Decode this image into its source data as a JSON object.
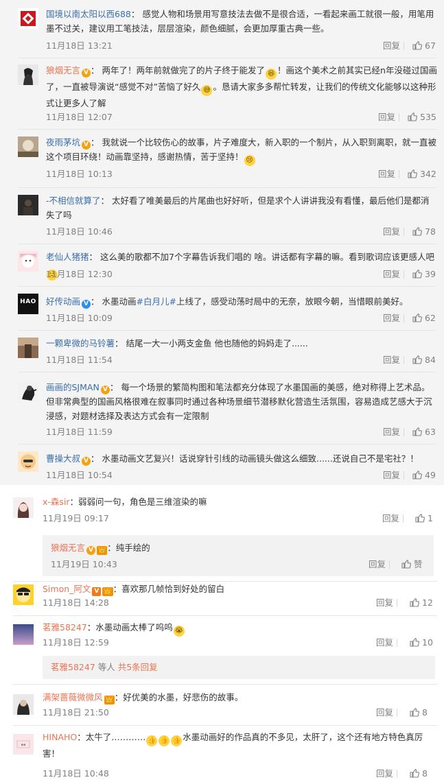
{
  "section_a": [
    {
      "name": "国境以南太阳以西688",
      "name_color": "blue",
      "badge": "",
      "text": "感觉人物和场景用写意技法去做不是很合适，一看起来画工就很一般，用笔用墨不过关，建议用工笔技法，层层渲染，颜色细腻，会更加厚重古典一些。",
      "time": "11月18日 13:21",
      "reply": "回复",
      "likes": "67"
    },
    {
      "name": "狼烟无言",
      "name_color": "orange",
      "badge": "V",
      "text1": "两年了！两年前就做完了的片子终于能发了",
      "text2": "！画这个美术之前其实已经n年没碰过国画了，一直被导演说“感觉不对”苦恼了好久",
      "text3": "。恳请大家多多帮忙转发，让我们的传统文化能够以这种形式让更多人了解",
      "time": "11月18日 12:07",
      "reply": "回复",
      "likes": "535"
    },
    {
      "name": "夜雨茅坑",
      "name_color": "blue",
      "badge": "V",
      "text1": "我就说一个比较伤心的故事，片子难度大，新入职的一个制片，从入职到离职，就一直被这个项目环绕！动画靠坚持，感谢热情，苦于坚持！",
      "time": "11月18日 10:13",
      "reply": "回复",
      "likes": "342"
    },
    {
      "name": "-不相信就算了",
      "name_color": "blue",
      "badge": "",
      "text": "太好看了唯美最后的片尾曲也好好听，但是求个人讲讲我没有看懂，最后他们是都消失了吗",
      "time": "11月18日 10:46",
      "reply": "回复",
      "likes": "78"
    },
    {
      "name": "老仙人猪猪",
      "name_color": "blue",
      "badge": "",
      "text": "这么美的歌都不加7个字幕告诉我们唱的 啥。讲话都有字幕的嘛。看到歌词应该更感人吧",
      "time": "11月18日 12:30",
      "reply": "回复",
      "likes": "39"
    },
    {
      "name": "好传动画",
      "name_color": "blue",
      "badge": "V",
      "text_a": "水墨动画",
      "text_link": "#白月儿#",
      "text_b": "上线了，感受动荡时局中的无奈，放眼今朝，当惜眼前美好。",
      "time": "11月18日 10:09",
      "reply": "回复",
      "likes": "62",
      "avatar_text": "HAO"
    },
    {
      "name": "一颗卑微的马铃薯",
      "name_color": "blue",
      "badge": "",
      "text": "结尾一大一小两支金鱼 他也随他的妈妈走了......",
      "time": "11月18日 11:54",
      "reply": "回复",
      "likes": "84"
    },
    {
      "name": "画画的SJMAN",
      "name_color": "blue",
      "badge": "V",
      "text": "每一个场景的繁简构图和笔法都充分体现了水墨国画的美感，绝对称得上艺术品。但非常典型的国画风格很难在叙事同时通过各种场景细节潜移默化营造生活氛围，容易造成艺感大于沉浸感，对题材选择及表达方式会有一定限制",
      "time": "11月18日 11:59",
      "reply": "回复",
      "likes": "63"
    },
    {
      "name": "曹操大叔",
      "name_color": "blue",
      "badge": "V",
      "text": "水墨动画文艺复兴！话说穿针引线的动画镜头做这么细致......还说自己不是宅社？！",
      "time": "11月18日 10:54",
      "reply": "回复",
      "likes": "49"
    }
  ],
  "section_b": {
    "c1": {
      "name": "x-森sir",
      "text": "：弱弱问一句，角色是三维渲染的嘛",
      "time": "11月19日 09:17",
      "reply": "回复",
      "likes": "1",
      "sub": {
        "name": "狼烟无言",
        "text": "：纯手绘的",
        "time": "11月19日 10:43",
        "reply": "回复",
        "likes": "赞"
      }
    },
    "c2": {
      "name": "Simon_阿文",
      "text": "：喜欢那几帧恰到好处的留白",
      "time": "11月18日 14:28",
      "reply": "回复",
      "likes": "12"
    },
    "c3": {
      "name": "茗雅58247",
      "text": "：水墨动画太棒了呜呜",
      "time": "11月18日 12:59",
      "reply": "回复",
      "likes": "10",
      "more_name": "茗雅58247",
      "more_mid": " 等人 ",
      "more_link": "共5条回复"
    },
    "c4": {
      "name": "满架蔷薇微微风",
      "text": "：好优美的水墨，好悲伤的故事。",
      "time": "11月18日 21:50",
      "reply": "回复",
      "likes": "8"
    },
    "c5": {
      "name": "HINAHO",
      "text1": "：太牛了…………",
      "text2": "水墨动画好的作品真的不多见，太肝了，这个还有地方特色真厉害！",
      "time": "11月18日 10:48",
      "reply": "回复",
      "likes": "8"
    }
  },
  "colors": {
    "link_blue": "#3b6eaa",
    "name_orange": "#eb7350",
    "meta_gray": "#808080",
    "bg_gray": "#f4f4f4"
  }
}
